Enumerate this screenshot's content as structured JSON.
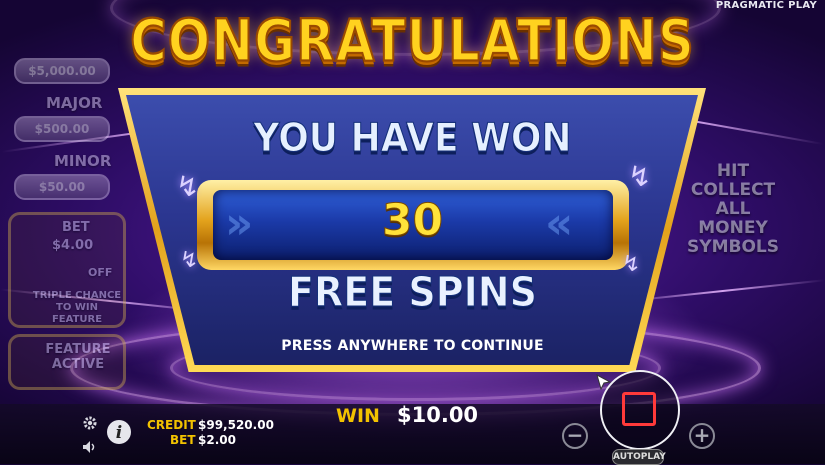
{
  "brand": "PRAGMATIC PLAY",
  "jackpots": [
    {
      "label": "",
      "value": "$5,000.00"
    },
    {
      "label": "MAJOR",
      "value": "$500.00"
    },
    {
      "label": "MINOR",
      "value": "$50.00"
    }
  ],
  "side_left": {
    "bet_label": "BET",
    "bet_value": "$4.00",
    "toggle": "OFF",
    "triple_chance": "TRIPLE CHANCE TO WIN FEATURE",
    "feature": "FEATURE ACTIVE"
  },
  "side_right": {
    "hint": "HIT COLLECT ALL MONEY SYMBOLS",
    "collect_icon": "collect-icon"
  },
  "popup": {
    "title": "CONGRATULATIONS",
    "line1": "YOU HAVE WON",
    "amount": "30",
    "line2": "FREE SPINS",
    "instruction": "PRESS ANYWHERE TO CONTINUE"
  },
  "bottom": {
    "credit_label": "CREDIT",
    "credit_value": "$99,520.00",
    "bet_label": "BET",
    "bet_value": "$2.00",
    "win_label": "WIN",
    "win_value": "$10.00",
    "autoplay_label": "AUTOPLAY",
    "icons": [
      "gear-icon",
      "info-icon",
      "sound-icon",
      "minus-icon",
      "stop-icon",
      "plus-icon"
    ]
  },
  "colors": {
    "gold": "#ffd21f",
    "label_yellow": "#f2c200",
    "panel_blue": "#2b3690",
    "stop_red": "#ff3a3a"
  }
}
